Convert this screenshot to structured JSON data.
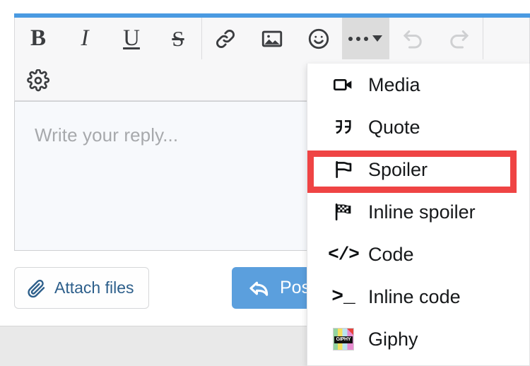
{
  "theme": {
    "accent_blue": "#4a9ae1",
    "post_button_blue": "#5b9fdd",
    "highlight_red": "#ef4444",
    "toolbar_bg": "#f7f7f8",
    "textarea_bg": "#f7f9fc",
    "footer_bg": "#e9e9e9",
    "link_text": "#2d5f8b",
    "placeholder_text": "#a7a9ac"
  },
  "toolbar": {
    "row1": [
      {
        "name": "bold",
        "label": "B",
        "icon": "bold-icon",
        "state": "normal"
      },
      {
        "name": "italic",
        "label": "I",
        "icon": "italic-icon",
        "state": "normal"
      },
      {
        "name": "underline",
        "label": "U",
        "icon": "underline-icon",
        "state": "normal"
      },
      {
        "name": "strikethrough",
        "label": "S",
        "icon": "strikethrough-icon",
        "state": "normal"
      },
      {
        "name": "link",
        "label": "",
        "icon": "link-icon",
        "state": "normal"
      },
      {
        "name": "image",
        "label": "",
        "icon": "image-icon",
        "state": "normal"
      },
      {
        "name": "emoji",
        "label": "",
        "icon": "smiley-icon",
        "state": "normal"
      },
      {
        "name": "more",
        "label": "",
        "icon": "ellipsis-caret-icon",
        "state": "active"
      },
      {
        "name": "undo",
        "label": "",
        "icon": "undo-icon",
        "state": "disabled"
      },
      {
        "name": "redo",
        "label": "",
        "icon": "redo-icon",
        "state": "disabled"
      }
    ],
    "row2": [
      {
        "name": "settings",
        "label": "",
        "icon": "gear-icon",
        "state": "normal"
      }
    ]
  },
  "editor": {
    "placeholder": "Write your reply...",
    "value": ""
  },
  "actions": {
    "attach_label": "Attach files",
    "attach_icon": "paperclip-icon",
    "post_label": "Post",
    "post_icon": "reply-arrow-icon"
  },
  "dropdown": {
    "open": true,
    "items": [
      {
        "label": "Media",
        "icon": "video-camera-icon",
        "highlighted": false
      },
      {
        "label": "Quote",
        "icon": "quote-marks-icon",
        "highlighted": false
      },
      {
        "label": "Spoiler",
        "icon": "flag-icon",
        "highlighted": true
      },
      {
        "label": "Inline spoiler",
        "icon": "checkered-flag-icon",
        "highlighted": false
      },
      {
        "label": "Code",
        "icon": "code-brackets-icon",
        "highlighted": false
      },
      {
        "label": "Inline code",
        "icon": "terminal-prompt-icon",
        "highlighted": false
      },
      {
        "label": "Giphy",
        "icon": "giphy-logo-icon",
        "highlighted": false
      }
    ]
  }
}
